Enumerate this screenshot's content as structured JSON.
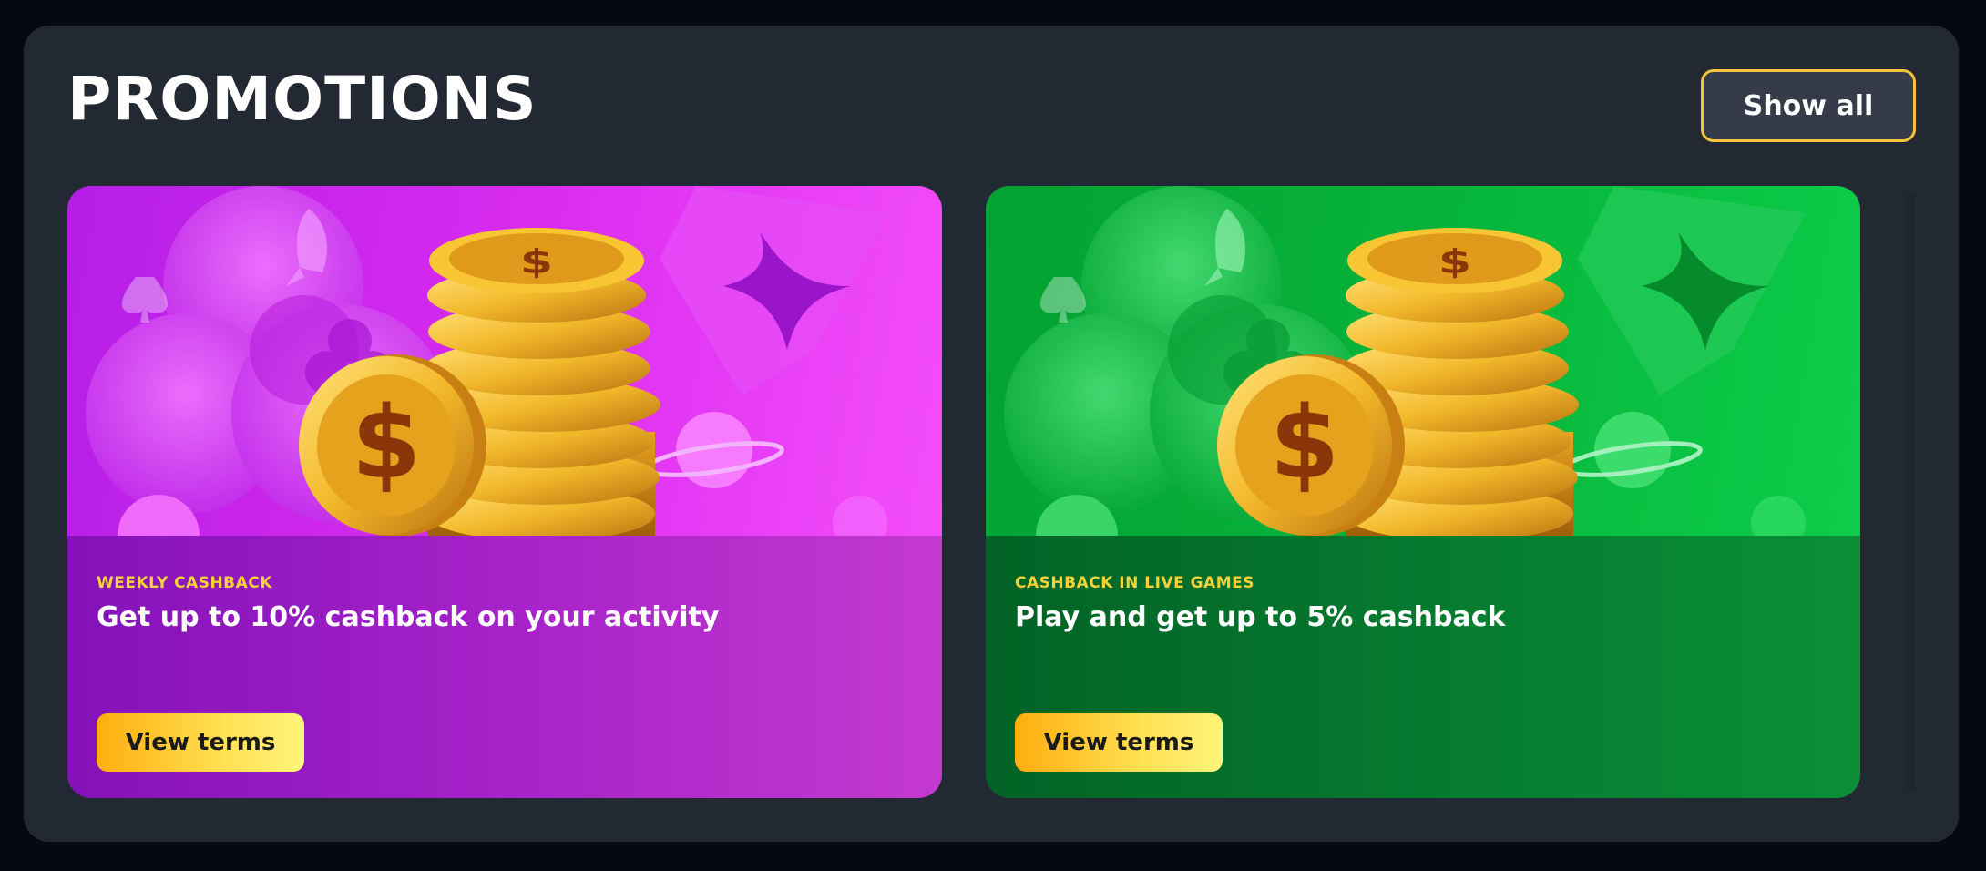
{
  "section": {
    "title": "PROMOTIONS",
    "show_all_label": "Show all"
  },
  "promotions": [
    {
      "tag": "WEEKLY CASHBACK",
      "headline": "Get up to 10% cashback on your activity",
      "button_label": "View terms",
      "theme": "purple",
      "art_color": "#d92bf0"
    },
    {
      "tag": "CASHBACK IN LIVE GAMES",
      "headline": "Play and get up to 5% cashback",
      "button_label": "View terms",
      "theme": "green",
      "art_color": "#06b43a"
    }
  ],
  "colors": {
    "background": "#050a12",
    "panel": "#232932",
    "accent_yellow": "#f5c33b",
    "tag_yellow": "#f4d23a"
  },
  "icons": {
    "artwork": "coin-stack-illustration",
    "decorations": [
      "club-shape",
      "diamond-shape",
      "rocket-icon",
      "planet-icon",
      "spade-shape",
      "dollar-coin-icon"
    ]
  }
}
